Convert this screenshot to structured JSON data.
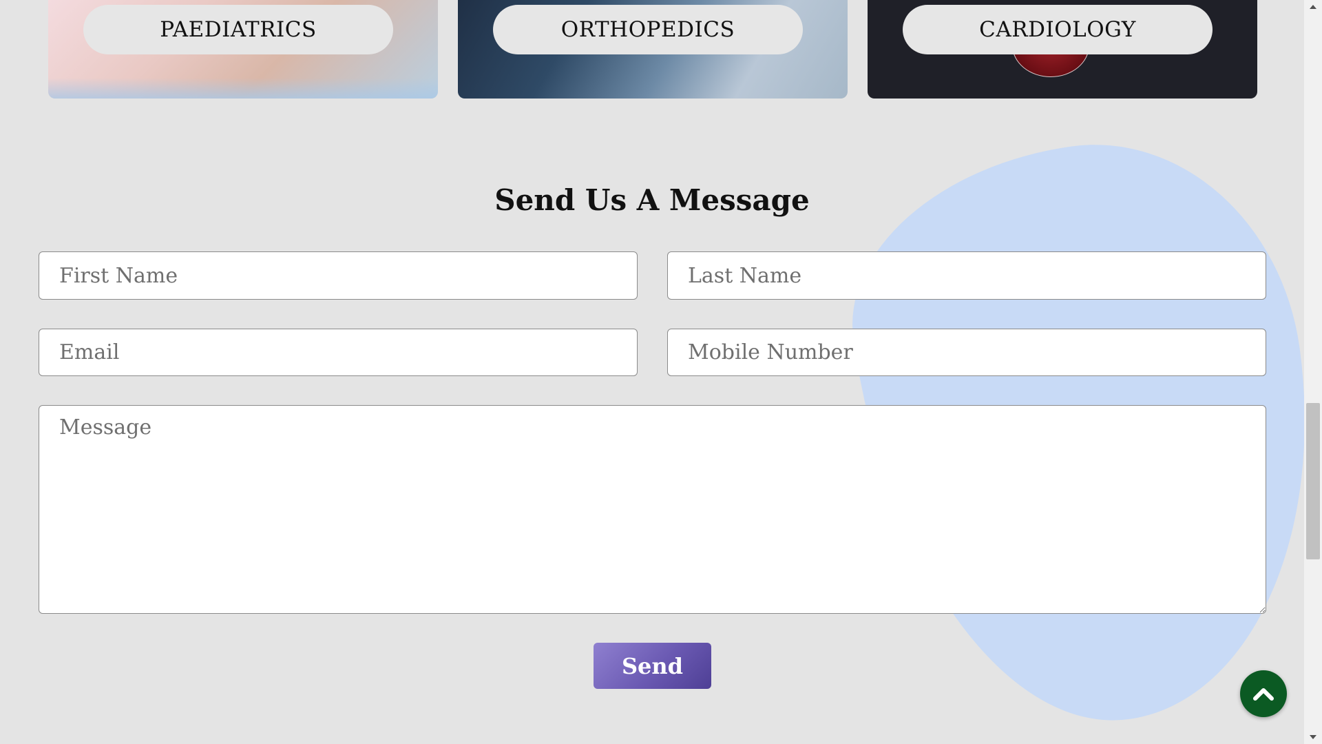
{
  "departments": [
    {
      "label": "PAEDIATRICS"
    },
    {
      "label": "ORTHOPEDICS"
    },
    {
      "label": "CARDIOLOGY"
    }
  ],
  "contact_form": {
    "title": "Send Us A Message",
    "first_name_placeholder": "First Name",
    "last_name_placeholder": "Last Name",
    "email_placeholder": "Email",
    "mobile_placeholder": "Mobile Number",
    "message_placeholder": "Message",
    "send_label": "Send"
  },
  "colors": {
    "background": "#e4e4e4",
    "blob": "#c8daf6",
    "send_button": "#6a59b2",
    "scroll_top_button": "#0b5a23"
  },
  "icons": {
    "scroll_top": "chevron-up-icon"
  }
}
